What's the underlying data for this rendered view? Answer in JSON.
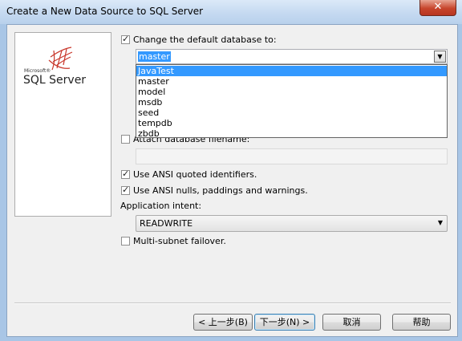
{
  "window": {
    "title": "Create a New Data Source to SQL Server",
    "close_label": "✕"
  },
  "logo": {
    "microsoft": "Microsoft®",
    "product": "SQL Server"
  },
  "change_db": {
    "label": "Change the default database to:",
    "checked": true,
    "value": "master"
  },
  "dropdown": {
    "items": [
      "JavaTest",
      "master",
      "model",
      "msdb",
      "seed",
      "tempdb",
      "zbdb"
    ],
    "selected": "JavaTest"
  },
  "attach": {
    "label": "Attach database filename:",
    "checked": false,
    "value": ""
  },
  "ansi_quoted": {
    "label": "Use ANSI quoted identifiers.",
    "checked": true
  },
  "ansi_nulls": {
    "label": "Use ANSI nulls, paddings and warnings.",
    "checked": true
  },
  "app_intent": {
    "label": "Application intent:",
    "value": "READWRITE"
  },
  "multisubnet": {
    "label": "Multi-subnet failover.",
    "checked": false
  },
  "buttons": {
    "back": "< 上一步(B)",
    "next": "下一步(N) >",
    "cancel": "取消",
    "help": "帮助"
  }
}
